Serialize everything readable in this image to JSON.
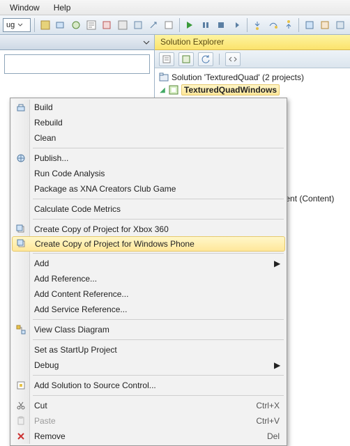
{
  "menubar": {
    "window": "Window",
    "help": "Help"
  },
  "toolbar": {
    "combo": "ug"
  },
  "explorer": {
    "title": "Solution Explorer",
    "solution": "Solution 'TexturedQuad' (2 projects)",
    "project": "TexturedQuadWindows",
    "content_node": "sContent (Content)"
  },
  "ctx": {
    "build": "Build",
    "rebuild": "Rebuild",
    "clean": "Clean",
    "publish": "Publish...",
    "runca": "Run Code Analysis",
    "pkg": "Package as XNA Creators Club Game",
    "metrics": "Calculate Code Metrics",
    "copy360": "Create Copy of Project for Xbox 360",
    "copywp": "Create Copy of Project for Windows Phone",
    "add": "Add",
    "addref": "Add Reference...",
    "addcontent": "Add Content Reference...",
    "addservice": "Add Service Reference...",
    "viewcd": "View Class Diagram",
    "startup": "Set as StartUp Project",
    "debug": "Debug",
    "addsrc": "Add Solution to Source Control...",
    "cut": "Cut",
    "cut_k": "Ctrl+X",
    "paste": "Paste",
    "paste_k": "Ctrl+V",
    "remove": "Remove",
    "remove_k": "Del"
  }
}
